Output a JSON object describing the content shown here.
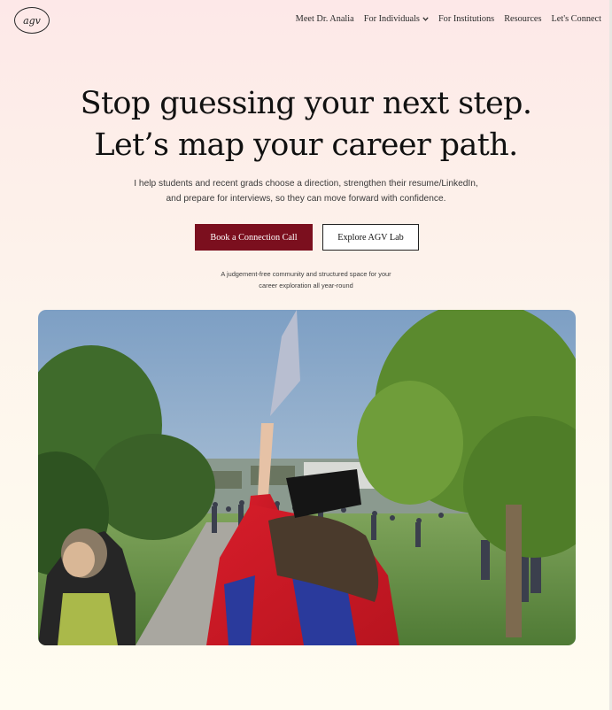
{
  "logo": {
    "text": "agv"
  },
  "nav": {
    "items": [
      {
        "label": "Meet Dr. Analia"
      },
      {
        "label": "For Individuals",
        "has_dropdown": true
      },
      {
        "label": "For Institutions"
      },
      {
        "label": "Resources"
      },
      {
        "label": "Let's Connect"
      }
    ]
  },
  "hero": {
    "headline_line1": "Stop guessing your next step.",
    "headline_line2": "Let’s map your career path.",
    "sub_line1": "I help students and recent grads choose a direction, strengthen their resume/LinkedIn,",
    "sub_line2": "and prepare for interviews, so they can move forward with confidence.",
    "primary_cta": "Book a Connection Call",
    "secondary_cta": "Explore AGV Lab",
    "note_line1": "A judgement-free community and structured space for your",
    "note_line2": "career exploration all year-round",
    "image_alt": "graduation photo"
  },
  "colors": {
    "primary_button": "#7b0f1e",
    "background_top": "#fde8e8",
    "background_bottom": "#fffcf1"
  },
  "icons": {
    "dropdown": "chevron-down-icon"
  }
}
